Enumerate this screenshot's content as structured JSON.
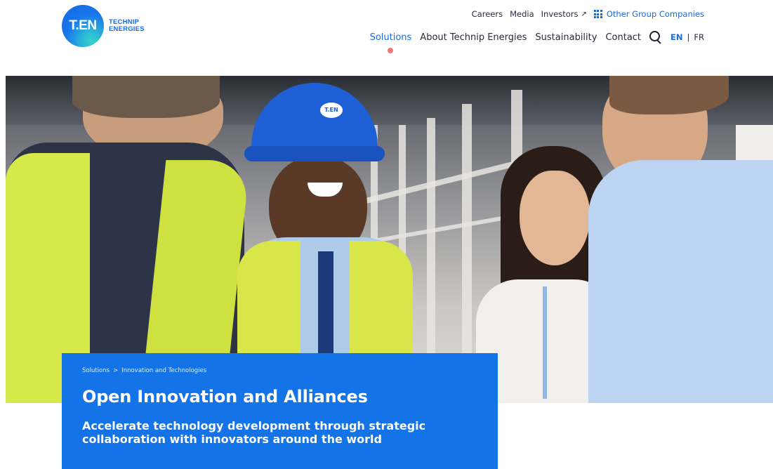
{
  "logo": {
    "mark": "T.EN",
    "line1": "TECHNIP",
    "line2": "ENERGIES"
  },
  "top_links": {
    "careers": "Careers",
    "media": "Media",
    "investors": "Investors",
    "investors_icon": "external-arrow-icon",
    "other_group": "Other Group Companies",
    "other_group_icon": "grid-icon"
  },
  "main_nav": {
    "items": [
      {
        "label": "Solutions",
        "active": true
      },
      {
        "label": "About Technip Energies",
        "active": false
      },
      {
        "label": "Sustainability",
        "active": false
      },
      {
        "label": "Contact",
        "active": false
      }
    ],
    "search_icon": "search-icon",
    "lang_en": "EN",
    "lang_sep": "|",
    "lang_fr": "FR"
  },
  "hero": {
    "helmet_logo": "T.EN"
  },
  "title_block": {
    "breadcrumb": [
      "Solutions",
      "Innovation and Technologies"
    ],
    "breadcrumb_sep": ">",
    "title": "Open Innovation and Alliances",
    "subtitle": "Accelerate technology development through strategic collaboration with innovators around the world"
  },
  "colors": {
    "brand_blue": "#1473e6",
    "link_blue": "#1a6bde",
    "active_dot": "#f07676"
  }
}
